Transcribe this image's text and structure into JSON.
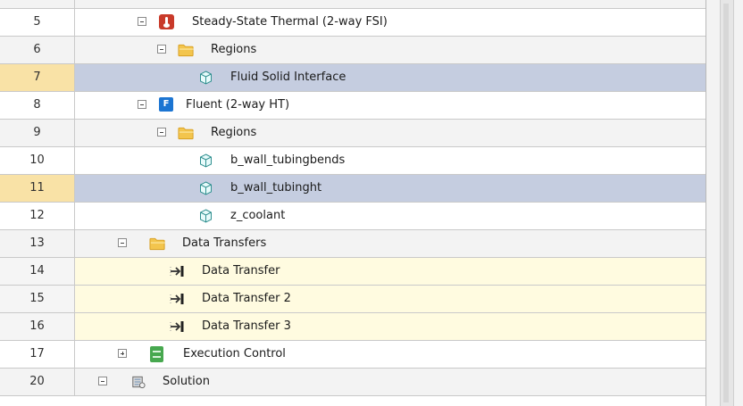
{
  "tree": {
    "rows": [
      {
        "number": "",
        "label": "",
        "kind": "cut",
        "style": "alt"
      },
      {
        "number": "5",
        "label": "Steady-State Thermal (2-way FSI)",
        "kind": "thermal",
        "style": "white"
      },
      {
        "number": "6",
        "label": "Regions",
        "kind": "folder",
        "style": "alt"
      },
      {
        "number": "7",
        "label": "Fluid Solid Interface",
        "kind": "region",
        "style": "selected"
      },
      {
        "number": "8",
        "label": "Fluent (2-way HT)",
        "kind": "fluent",
        "style": "white"
      },
      {
        "number": "9",
        "label": "Regions",
        "kind": "folder",
        "style": "alt"
      },
      {
        "number": "10",
        "label": "b_wall_tubingbends",
        "kind": "region",
        "style": "white"
      },
      {
        "number": "11",
        "label": "b_wall_tubinght",
        "kind": "region",
        "style": "selected"
      },
      {
        "number": "12",
        "label": "z_coolant",
        "kind": "region",
        "style": "white"
      },
      {
        "number": "13",
        "label": "Data Transfers",
        "kind": "folder",
        "style": "alt"
      },
      {
        "number": "14",
        "label": "Data Transfer",
        "kind": "transfer",
        "style": "transfer"
      },
      {
        "number": "15",
        "label": "Data Transfer 2",
        "kind": "transfer",
        "style": "transfer"
      },
      {
        "number": "16",
        "label": "Data Transfer 3",
        "kind": "transfer",
        "style": "transfer"
      },
      {
        "number": "17",
        "label": "Execution Control",
        "kind": "execution",
        "style": "white"
      },
      {
        "number": "20",
        "label": "Solution",
        "kind": "solution",
        "style": "alt"
      }
    ]
  },
  "colors": {
    "selected_row": "#c5cde0",
    "selected_number": "#f9e2a6",
    "transfer_row": "#fffbe0",
    "folder": "#f3c54d",
    "region_icon": "#2f8f8f"
  },
  "icons": {
    "thermal": "thermal-system-icon",
    "fluent": "fluent-system-icon",
    "folder": "folder-icon",
    "region": "region-cube-icon",
    "transfer": "data-transfer-icon",
    "execution": "execution-control-icon",
    "solution": "solution-icon"
  }
}
